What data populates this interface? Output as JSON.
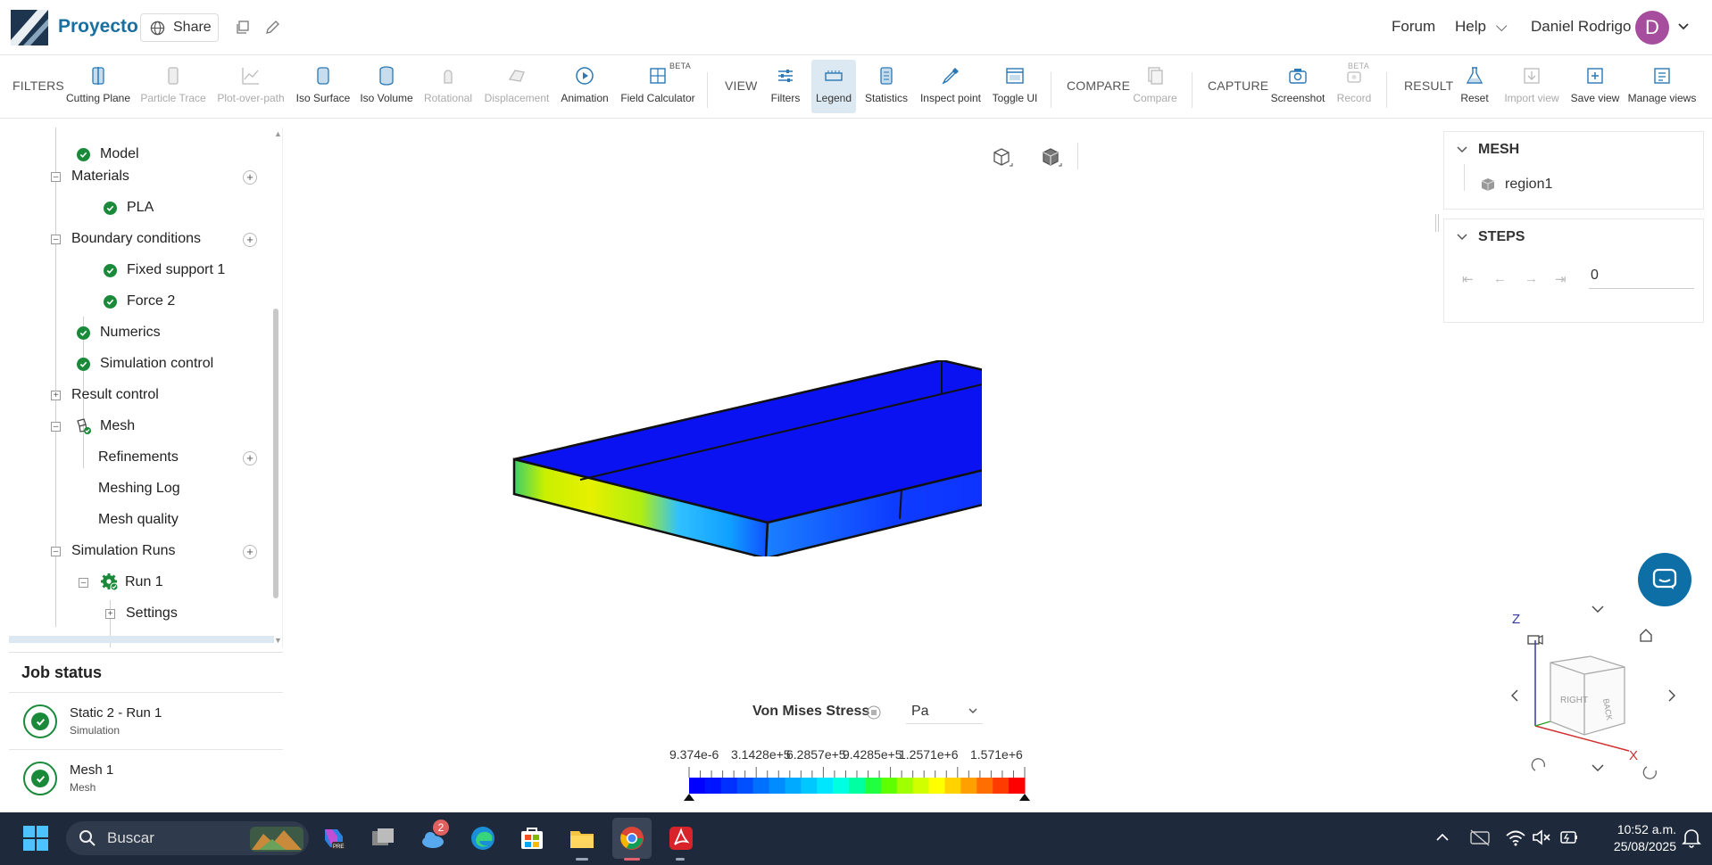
{
  "header": {
    "brand": "Proyecto",
    "share_label": "Share",
    "forum_label": "Forum",
    "help_label": "Help",
    "user_name": "Daniel Rodrigo",
    "avatar_letter": "D"
  },
  "toolbar": {
    "filters_section": "FILTERS",
    "view_section": "VIEW",
    "compare_section": "COMPARE",
    "capture_section": "CAPTURE",
    "result_section": "RESULT",
    "beta": "BETA",
    "items": {
      "cutting_plane": "Cutting Plane",
      "particle_trace": "Particle Trace",
      "plot_over_path": "Plot-over-path",
      "iso_surface": "Iso Surface",
      "iso_volume": "Iso Volume",
      "rotational": "Rotational",
      "displacement": "Displacement",
      "animation": "Animation",
      "field_calculator": "Field Calculator",
      "filters": "Filters",
      "legend": "Legend",
      "statistics": "Statistics",
      "inspect_point": "Inspect point",
      "toggle_ui": "Toggle UI",
      "compare": "Compare",
      "screenshot": "Screenshot",
      "record": "Record",
      "reset": "Reset",
      "import_view": "Import view",
      "save_view": "Save view",
      "manage_views": "Manage views"
    }
  },
  "tree": {
    "model": "Model",
    "materials": "Materials",
    "pla": "PLA",
    "boundary_conditions": "Boundary conditions",
    "fixed_support": "Fixed support 1",
    "force": "Force 2",
    "numerics": "Numerics",
    "simulation_control": "Simulation control",
    "result_control": "Result control",
    "mesh": "Mesh",
    "refinements": "Refinements",
    "meshing_log": "Meshing Log",
    "mesh_quality": "Mesh quality",
    "simulation_runs": "Simulation Runs",
    "run1": "Run 1",
    "settings": "Settings"
  },
  "job_status": {
    "title": "Job status",
    "jobs": [
      {
        "name": "Static 2 - Run 1",
        "type": "Simulation"
      },
      {
        "name": "Mesh 1",
        "type": "Mesh"
      }
    ]
  },
  "right_panel": {
    "mesh_title": "MESH",
    "region": "region1",
    "steps_title": "STEPS",
    "step_value": "0"
  },
  "legend": {
    "title": "Von Mises Stress",
    "unit": "Pa",
    "ticks": [
      "9.374e-6",
      "3.1428e+5",
      "6.2857e+5",
      "9.4285e+5",
      "1.2571e+6",
      "1.571e+6"
    ],
    "colors": [
      "#0000ff",
      "#0014ff",
      "#0030ff",
      "#0050ff",
      "#0070ff",
      "#008cff",
      "#00aaff",
      "#00c8ff",
      "#00e6ff",
      "#00ffe0",
      "#00ffa0",
      "#20ff40",
      "#60ff00",
      "#a0ff00",
      "#d0ff00",
      "#ffff00",
      "#ffd200",
      "#ffa000",
      "#ff6e00",
      "#ff3c00",
      "#ff0000"
    ]
  },
  "nav_cube": {
    "z_label": "Z",
    "x_label": "X",
    "right_face": "RIGHT",
    "back_face": "BACK"
  },
  "taskbar": {
    "search_placeholder": "Buscar",
    "badge": "2",
    "time": "10:52 a.m.",
    "date": "25/08/2025"
  }
}
